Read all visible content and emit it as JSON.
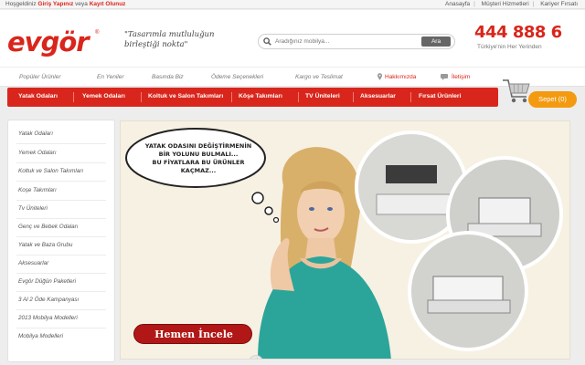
{
  "topbar": {
    "welcome": "Hoşgeldiniz",
    "login": "Giriş Yapınız",
    "or": "veya",
    "register": "Kayıt Olunuz",
    "links": [
      "Anasayfa",
      "Müşteri Hizmetleri",
      "Kariyer Fırsatı"
    ]
  },
  "header": {
    "logo": "evgör",
    "logo_mark": "®",
    "slogan_line1": "\"Tasarımla mutluluğun",
    "slogan_line2": "birleştiği nokta\"",
    "search_placeholder": "Aradığınız mobilya...",
    "search_button": "Ara",
    "phone": "444 888 6",
    "phone_sub": "Türkiye'nin Her Yerinden"
  },
  "subnav": [
    "Popüler Ürünler",
    "En Yeniler",
    "Basında Biz",
    "Ödeme Seçenekleri",
    "Kargo ve Teslimat",
    "Hakkımızda",
    "İletişim"
  ],
  "mainnav": [
    "Yatak Odaları",
    "Yemek Odaları",
    "Koltuk ve Salon Takımları",
    "Köşe Takımları",
    "TV Üniteleri",
    "Aksesuarlar",
    "Fırsat Ürünleri"
  ],
  "cart": {
    "label": "Sepet",
    "count": "(0)"
  },
  "sidebar": [
    "Yatak Odaları",
    "Yemek Odaları",
    "Koltuk ve Salon Takımları",
    "Koşe Takımları",
    "Tv Üniteleri",
    "Genç ve Bebek Odaları",
    "Yatak ve Baza Grubu",
    "Aksesuarlar",
    "Evgör Düğün Paketleri",
    "3 Al 2 Öde Kampanyası",
    "2013 Mobilya Modelleri",
    "Mobilya Modelleri"
  ],
  "banner": {
    "bubble_line1": "YATAK ODASINI DEĞİŞTİRMENİN",
    "bubble_line2": "BİR YOLUNU BULMALI...",
    "bubble_line3": "BU FİYATLARA BU ÜRÜNLER",
    "bubble_line4": "KAÇMAZ...",
    "cta": "Hemen İncele"
  },
  "colors": {
    "brand_red": "#d9261c",
    "cart_orange": "#f39a10"
  }
}
